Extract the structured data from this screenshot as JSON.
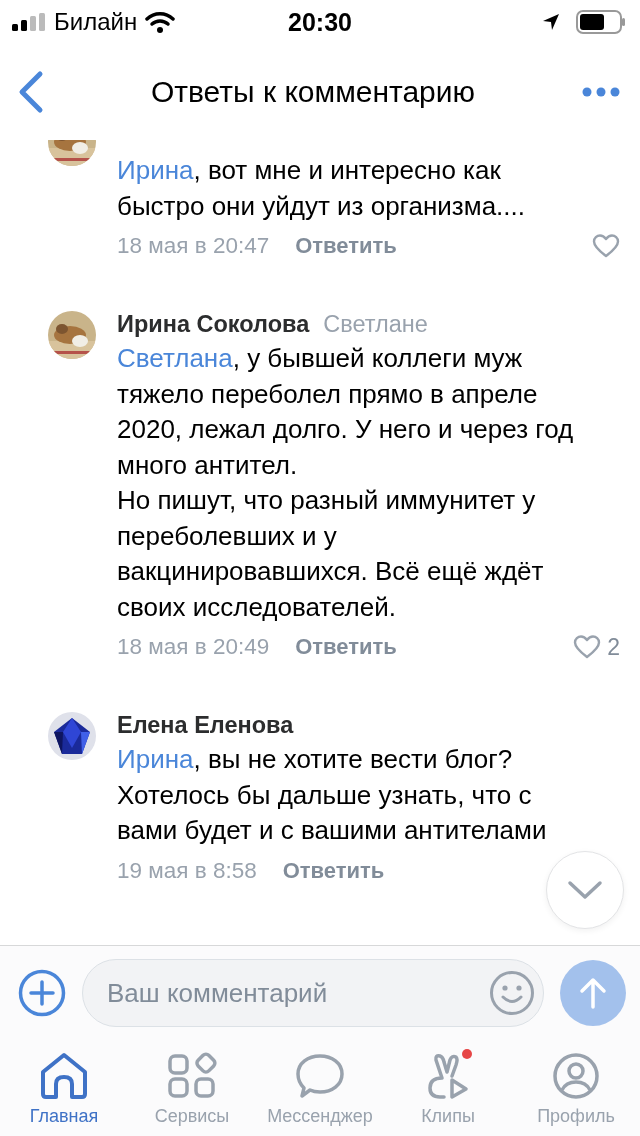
{
  "status_bar": {
    "carrier": "Билайн",
    "time": "20:30"
  },
  "header": {
    "title": "Ответы к комментарию"
  },
  "comments": [
    {
      "mention": "Ирина",
      "text": ", вот мне и интересно как быстро они уйдут из организма....",
      "date": "18 мая в 20:47",
      "reply": "Ответить",
      "heart": true
    },
    {
      "author": "Ирина Соколова",
      "addressee": "Светлане",
      "mention": "Светлана",
      "text": ", у бывшей коллеги муж тяжело переболел прямо в апреле 2020, лежал долго. У него и через год много антител.\nНо пишут, что разный иммунитет у переболевших и у вакцинировавшихся. Всё ещё ждёт своих исследователей.",
      "date": "18 мая в 20:49",
      "reply": "Ответить",
      "heart": true,
      "likes": "2"
    },
    {
      "author": "Елена Еленова",
      "mention": "Ирина",
      "text": ", вы не хотите вести блог? Хотелось бы дальше узнать, что с вами будет и с вашими антителами",
      "date": "19 мая в 8:58",
      "reply": "Ответить",
      "heart": false
    }
  ],
  "composer": {
    "placeholder": "Ваш комментарий"
  },
  "tabs": [
    {
      "label": "Главная",
      "selected": true,
      "badge": false
    },
    {
      "label": "Сервисы",
      "selected": false,
      "badge": false
    },
    {
      "label": "Мессенджер",
      "selected": false,
      "badge": false
    },
    {
      "label": "Клипы",
      "selected": false,
      "badge": true
    },
    {
      "label": "Профиль",
      "selected": false,
      "badge": false
    }
  ]
}
